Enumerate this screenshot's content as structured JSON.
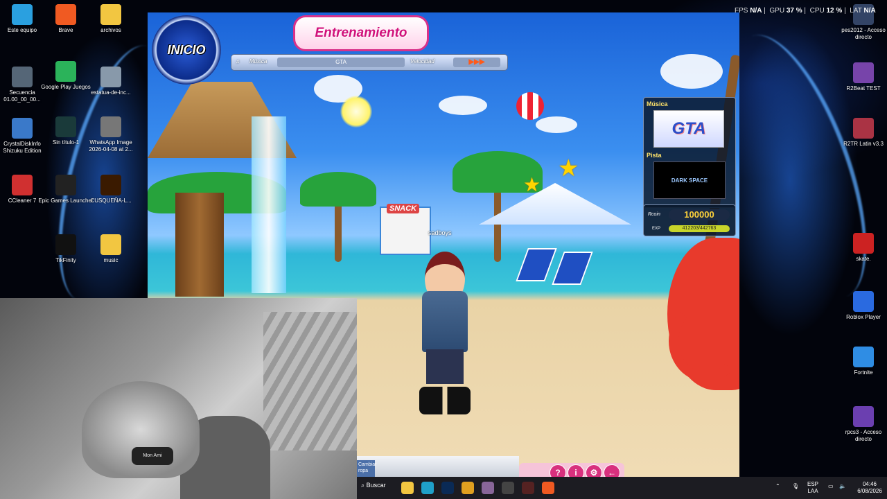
{
  "desktop": {
    "icons_left": [
      {
        "label": "Este equipo",
        "color": "#2aa0e0"
      },
      {
        "label": "Brave",
        "color": "#f05a22"
      },
      {
        "label": "archivos",
        "color": "#f2c641"
      },
      {
        "label": "Secuencia 01.00_00_00...",
        "color": "#556677"
      },
      {
        "label": "Google Play Juegos",
        "color": "#2bb35a"
      },
      {
        "label": "estatua-de-inc...",
        "color": "#8899aa"
      },
      {
        "label": "CrystalDiskInfo Shizuku Edition",
        "color": "#3a79c9"
      },
      {
        "label": "Sin título-1",
        "color": "#1a3a3a"
      },
      {
        "label": "WhatsApp Image 2026-04-08 at 2...",
        "color": "#777777"
      },
      {
        "label": "CCleaner 7",
        "color": "#d03030"
      },
      {
        "label": "Epic Games Launcher",
        "color": "#222222"
      },
      {
        "label": "CUSQUEÑA-L...",
        "color": "#3a1a00"
      },
      {
        "label": "TikFinity",
        "color": "#111111"
      },
      {
        "label": "music",
        "color": "#f2c641"
      }
    ],
    "icons_right": [
      {
        "label": "pes2012 - Acceso directo",
        "color": "#334466"
      },
      {
        "label": "R2Beat TEST",
        "color": "#7744aa"
      },
      {
        "label": "R2TR Latin v3.3",
        "color": "#aa3344"
      },
      {
        "label": "skate.",
        "color": "#cc2222"
      },
      {
        "label": "Roblox Player",
        "color": "#2a6ae0"
      },
      {
        "label": "Fortnite",
        "color": "#2f8de4"
      },
      {
        "label": "rpcs3 - Acceso directo",
        "color": "#6b3fb0"
      }
    ],
    "hud": {
      "fps_label": "FPS",
      "fps_value": "N/A",
      "gpu_label": "GPU",
      "gpu_value": "37 %",
      "cpu_label": "CPU",
      "cpu_value": "12 %",
      "lat_label": "LAT",
      "lat_value": "N/A"
    }
  },
  "game": {
    "inicio_label": "INICIO",
    "title": "Entrenamiento",
    "music_label": "Música",
    "song_name": "GTA",
    "speed_label": "Velocidad",
    "speed_value": "▶▶▶",
    "snack_sign": "SNACK",
    "player_name": "sadboys",
    "side_panel": {
      "music_heading": "Música",
      "cover_text": "GTA",
      "track_heading": "Pista",
      "track_name": "DARK SPACE"
    },
    "currency": {
      "label": "Rcoin",
      "value": "100000",
      "exp_label": "EXP",
      "exp_value": "412203/442763"
    },
    "bottom_button": "Cambiar ropa",
    "action_buttons": [
      "?",
      "i",
      "⚙",
      "←"
    ]
  },
  "webcam": {
    "cap_text": "Mon Ami"
  },
  "taskbar": {
    "search_label": "Buscar",
    "apps": [
      {
        "name": "file-explorer",
        "color": "#f2c641"
      },
      {
        "name": "edge",
        "color": "#1fa0c9"
      },
      {
        "name": "photoshop",
        "color": "#0a2a55"
      },
      {
        "name": "chrome",
        "color": "#e0a020"
      },
      {
        "name": "game",
        "color": "#886699"
      },
      {
        "name": "obs",
        "color": "#444444"
      },
      {
        "name": "app",
        "color": "#552222"
      },
      {
        "name": "brave",
        "color": "#f05a22"
      }
    ],
    "lang_top": "ESP",
    "lang_bottom": "LAA",
    "time": "04:46",
    "date": "6/08/2026"
  }
}
